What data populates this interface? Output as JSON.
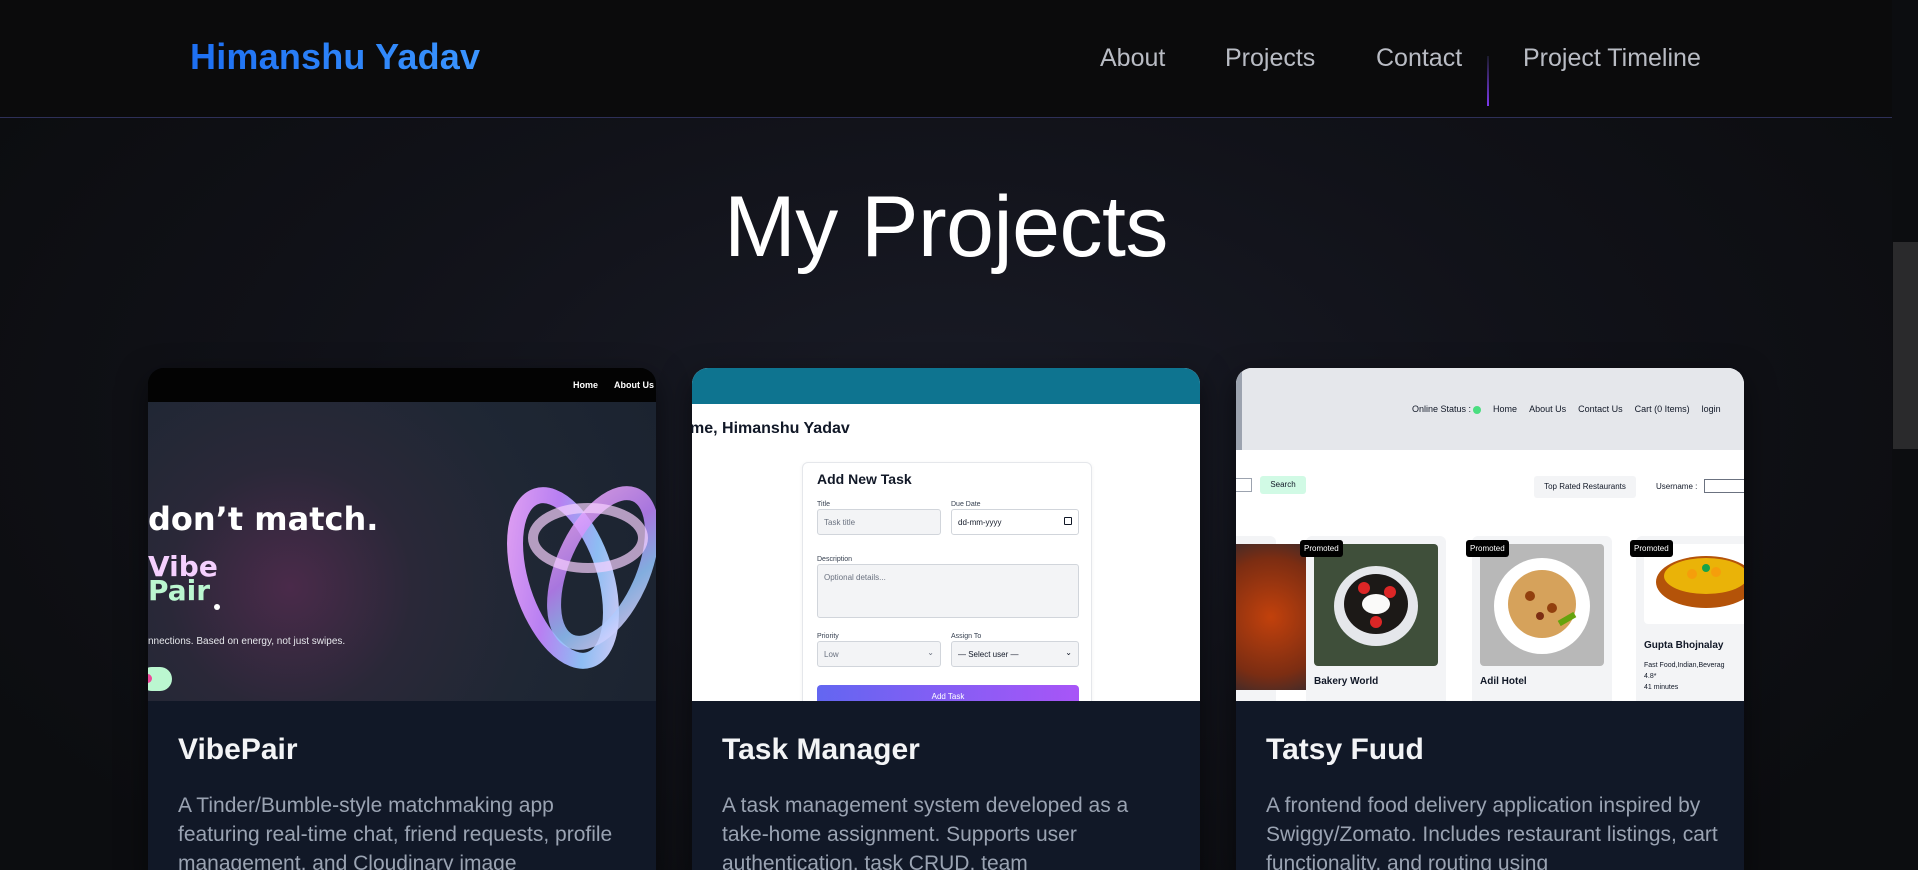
{
  "header": {
    "brand": "Himanshu Yadav",
    "nav": [
      "About",
      "Projects",
      "Contact",
      "Project Timeline"
    ]
  },
  "page_title": "My Projects",
  "projects": [
    {
      "title": "VibePair",
      "description": "A Tinder/Bumble-style matchmaking app featuring real-time chat, friend requests, profile management, and Cloudinary image",
      "preview": {
        "nav": [
          "Home",
          "About Us"
        ],
        "headline": "don’t match.",
        "logo_line1": "Vibe",
        "logo_line2": "Pair",
        "tagline": "nnections. Based on energy, not just swipes."
      }
    },
    {
      "title": "Task Manager",
      "description": "A task management system developed as a take-home assignment. Supports user authentication, task CRUD, team",
      "preview": {
        "welcome": "me, Himanshu Yadav",
        "form_title": "Add New Task",
        "title_label": "Title",
        "title_placeholder": "Task title",
        "due_label": "Due Date",
        "due_value": "dd-mm-yyyy",
        "desc_label": "Description",
        "desc_placeholder": "Optional details...",
        "priority_label": "Priority",
        "priority_value": "Low",
        "assign_label": "Assign To",
        "assign_value": "— Select user —",
        "submit": "Add Task"
      }
    },
    {
      "title": "Tatsy Fuud",
      "description": "A frontend food delivery application inspired by Swiggy/Zomato. Includes restaurant listings, cart functionality, and routing using",
      "preview": {
        "online_status": "Online Status :",
        "nav": [
          "Home",
          "About Us",
          "Contact Us",
          "Cart (0 Items)",
          "login"
        ],
        "search": "Search",
        "top_rated": "Top Rated Restaurants",
        "username_label": "Username :",
        "promoted": "Promoted",
        "restaurants": [
          {
            "name": "Bakery World"
          },
          {
            "name": "Adil Hotel"
          },
          {
            "name": "Gupta Bhojnalay",
            "cuisine": "Fast Food,Indian,Beverag",
            "rating": "4.8*",
            "time": "41 minutes"
          }
        ]
      }
    }
  ],
  "colors": {
    "brand": "#1d6ff2",
    "background": "#0c0d10",
    "card": "#111827",
    "task_header": "#0e7490"
  }
}
